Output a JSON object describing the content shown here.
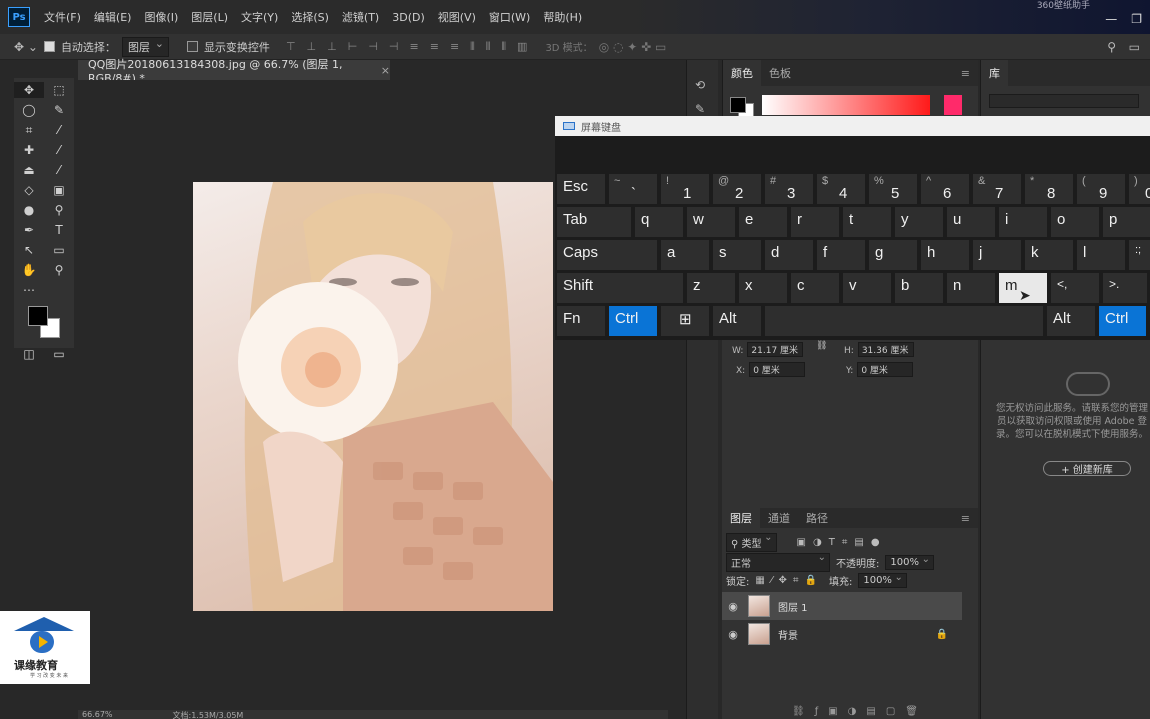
{
  "menubar": {
    "logo": "Ps",
    "items": [
      "文件(F)",
      "编辑(E)",
      "图像(I)",
      "图层(L)",
      "文字(Y)",
      "选择(S)",
      "滤镜(T)",
      "3D(D)",
      "视图(V)",
      "窗口(W)",
      "帮助(H)"
    ],
    "top_right_caption": "360壁纸助手"
  },
  "options": {
    "auto_select_label": "自动选择：",
    "auto_select_value": "图层",
    "show_transform_label": "显示变换控件",
    "mode_3d_label": "3D 模式："
  },
  "document": {
    "tab_title": "QQ图片20180613184308.jpg @ 66.7% (图层 1, RGB/8#) *",
    "zoom": "66.67%",
    "doc_info": "文档:1.53M/3.05M"
  },
  "color_panel": {
    "tabs": [
      "颜色",
      "色板"
    ],
    "fg_color": "#000000",
    "bg_color": "#ffffff"
  },
  "library_panel": {
    "tab": "库",
    "message": "您无权访问此服务。请联系您的管理员以获取访问权限或使用 Adobe 登录。您可以在脱机模式下使用服务。",
    "create_button": "+ 创建新库"
  },
  "properties": {
    "w_label": "W:",
    "w_value": "21.17 厘米",
    "h_label": "H:",
    "h_value": "31.36 厘米",
    "x_label": "X:",
    "x_value": "0 厘米",
    "y_label": "Y:",
    "y_value": "0 厘米"
  },
  "layers_panel": {
    "tabs": [
      "图层",
      "通道",
      "路径"
    ],
    "filter_label": "类型",
    "blend_mode": "正常",
    "opacity_label": "不透明度:",
    "opacity_value": "100%",
    "lock_label": "锁定:",
    "fill_label": "填充:",
    "fill_value": "100%",
    "layers": [
      {
        "name": "图层 1",
        "selected": true,
        "locked": false
      },
      {
        "name": "背景",
        "selected": false,
        "locked": true
      }
    ]
  },
  "keyboard": {
    "title": "屏幕键盘",
    "row1": [
      {
        "main": "Esc"
      },
      {
        "shift": "~",
        "lower": "`"
      },
      {
        "shift": "!",
        "lower": "1"
      },
      {
        "shift": "@",
        "lower": "2"
      },
      {
        "shift": "#",
        "lower": "3"
      },
      {
        "shift": "$",
        "lower": "4"
      },
      {
        "shift": "%",
        "lower": "5"
      },
      {
        "shift": "^",
        "lower": "6"
      },
      {
        "shift": "&",
        "lower": "7"
      },
      {
        "shift": "*",
        "lower": "8"
      },
      {
        "shift": "(",
        "lower": "9"
      },
      {
        "shift": ")",
        "lower": "0"
      }
    ],
    "row2": [
      "Tab",
      "q",
      "w",
      "e",
      "r",
      "t",
      "y",
      "u",
      "i",
      "o",
      "p"
    ],
    "row3": [
      "Caps",
      "a",
      "s",
      "d",
      "f",
      "g",
      "h",
      "j",
      "k",
      "l",
      ":;"
    ],
    "row4": [
      "Shift",
      "z",
      "x",
      "c",
      "v",
      "b",
      "n",
      "m",
      "<,",
      ">.",
      "?/"
    ],
    "row5": [
      "Fn",
      "Ctrl",
      "⊞",
      "Alt",
      "",
      "Alt",
      "Ctrl"
    ],
    "highlighted_key": "m"
  },
  "brand": {
    "name": "课缘教育",
    "sub": "学 习 改 变 未 来"
  }
}
